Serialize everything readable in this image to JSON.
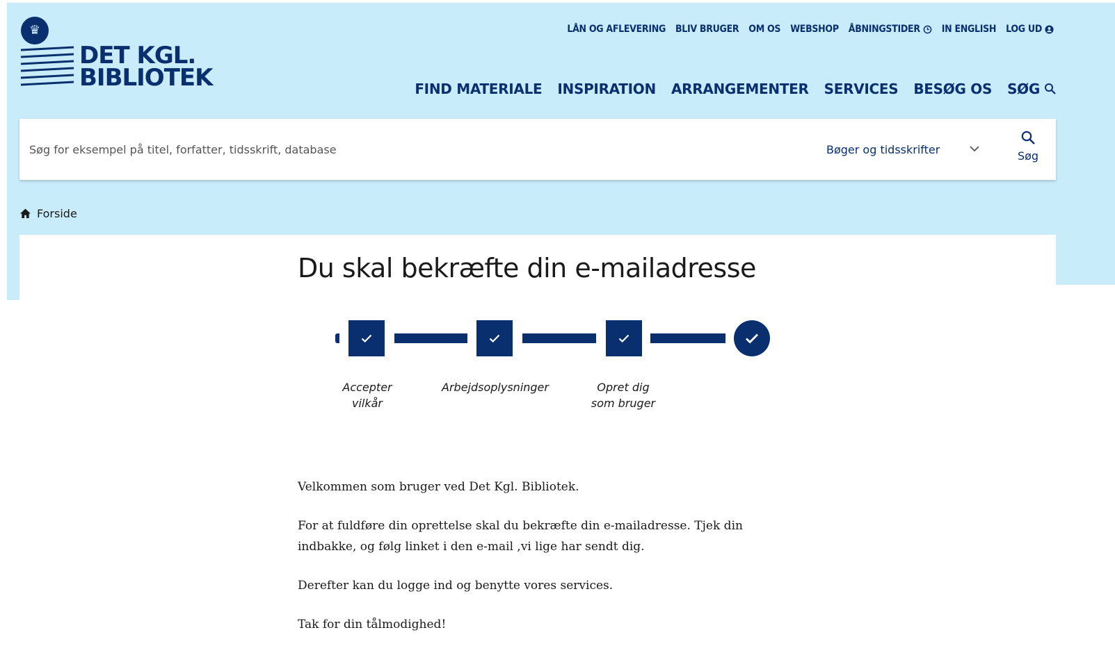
{
  "brand": {
    "line1": "DET KGL.",
    "line2": "BIBLIOTEK",
    "icon": "crown-icon",
    "color": "#0a2f6e",
    "background": "#c9ecfb"
  },
  "util_nav": {
    "items": [
      {
        "label": "LÅN OG AFLEVERING"
      },
      {
        "label": "BLIV BRUGER"
      },
      {
        "label": "OM OS"
      },
      {
        "label": "WEBSHOP"
      },
      {
        "label": "ÅBNINGSTIDER",
        "icon": "clock-icon"
      },
      {
        "label": "IN ENGLISH"
      },
      {
        "label": "LOG UD",
        "icon": "user-icon"
      }
    ]
  },
  "main_nav": {
    "items": [
      {
        "label": "FIND MATERIALE"
      },
      {
        "label": "INSPIRATION"
      },
      {
        "label": "ARRANGEMENTER"
      },
      {
        "label": "SERVICES"
      },
      {
        "label": "BESØG OS"
      },
      {
        "label": "SØG",
        "icon": "search-icon"
      }
    ]
  },
  "search": {
    "placeholder": "Søg for eksempel på titel, forfatter, tidsskrift, database",
    "value": "",
    "category": "Bøger og tidsskrifter",
    "button_label": "Søg"
  },
  "breadcrumb": {
    "home_label": "Forside"
  },
  "page": {
    "title": "Du skal bekræfte din e-mailadresse"
  },
  "stepper": {
    "steps": [
      {
        "label": "Accepter vilkår",
        "status": "complete"
      },
      {
        "label": "Arbejdsoplysninger",
        "status": "complete"
      },
      {
        "label": "Opret dig som bruger",
        "status": "complete"
      },
      {
        "label": "",
        "status": "complete"
      }
    ]
  },
  "body": {
    "paragraphs": [
      "Velkommen som bruger ved Det Kgl. Bibliotek.",
      "For at fuldføre din oprettelse skal du bekræfte din e-mailadresse. Tjek din indbakke, og følg linket i den e-mail ,vi lige har sendt dig.",
      "Derefter kan du logge ind og benytte vores services.",
      "Tak for din tålmodighed!"
    ]
  }
}
